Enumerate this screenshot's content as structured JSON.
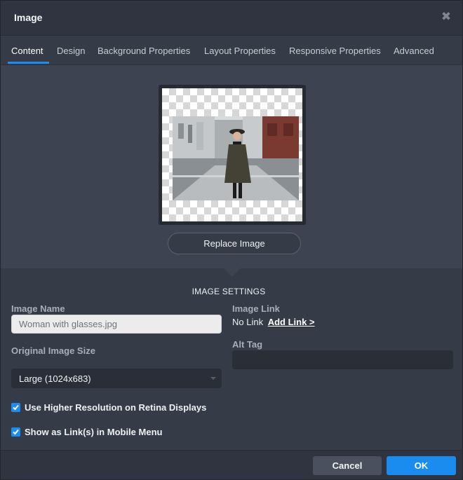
{
  "dialog": {
    "title": "Image",
    "close_icon": "close-icon"
  },
  "tabs": [
    {
      "label": "Content",
      "active": true
    },
    {
      "label": "Design",
      "active": false
    },
    {
      "label": "Background Properties",
      "active": false
    },
    {
      "label": "Layout Properties",
      "active": false
    },
    {
      "label": "Responsive Properties",
      "active": false
    },
    {
      "label": "Advanced",
      "active": false
    }
  ],
  "preview": {
    "replace_label": "Replace Image"
  },
  "settings": {
    "section_title": "IMAGE SETTINGS",
    "image_name_label": "Image Name",
    "image_name_value": "Woman with glasses.jpg",
    "original_size_label": "Original Image Size",
    "original_size_value": "Large (1024x683)",
    "image_link_label": "Image Link",
    "no_link_text": "No Link",
    "add_link_label": "Add Link >",
    "alt_tag_label": "Alt Tag",
    "alt_tag_value": "",
    "retina_label": "Use Higher Resolution on Retina Displays",
    "retina_checked": true,
    "mobile_menu_label": "Show as Link(s) in Mobile Menu",
    "mobile_menu_checked": true
  },
  "footer": {
    "cancel_label": "Cancel",
    "ok_label": "OK"
  },
  "colors": {
    "accent": "#1d8cf0",
    "panel": "#353b47",
    "preview_bg": "#3d4351"
  }
}
